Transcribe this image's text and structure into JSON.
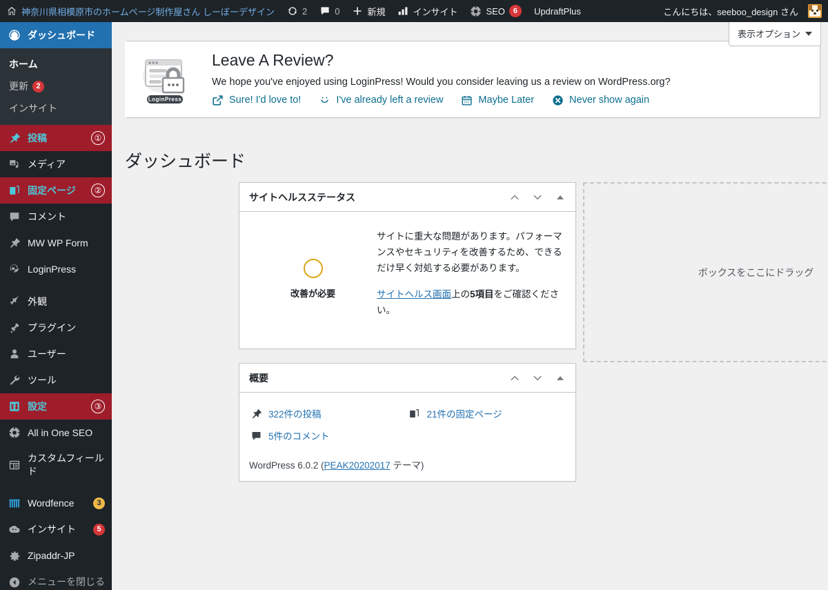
{
  "adminbar": {
    "site_name": "神奈川県相模原市のホームページ制作屋さん しーぼーデザイン",
    "updates_count": "2",
    "comments_count": "0",
    "new_label": "新規",
    "insight_label": "インサイト",
    "seo_label": "SEO",
    "seo_badge": "6",
    "updraftplus_label": "UpdraftPlus",
    "howdy": "こんにちは、seeboo_design さん"
  },
  "sidebar": {
    "items": [
      {
        "label": "ダッシュボード",
        "icon": "dashboard-icon",
        "state": "current",
        "marker": "",
        "badge": ""
      },
      {
        "label": "投稿",
        "icon": "pin-icon",
        "state": "flagged",
        "marker": "①",
        "badge": ""
      },
      {
        "label": "メディア",
        "icon": "media-icon",
        "state": "",
        "marker": "",
        "badge": ""
      },
      {
        "label": "固定ページ",
        "icon": "pages-icon",
        "state": "flagged",
        "marker": "②",
        "badge": ""
      },
      {
        "label": "コメント",
        "icon": "comment-icon",
        "state": "",
        "marker": "",
        "badge": ""
      },
      {
        "label": "MW WP Form",
        "icon": "pin-icon",
        "state": "",
        "marker": "",
        "badge": ""
      },
      {
        "label": "LoginPress",
        "icon": "loginpress-icon",
        "state": "",
        "marker": "",
        "badge": ""
      },
      {
        "label": "外観",
        "icon": "appearance-icon",
        "state": "",
        "marker": "",
        "badge": "",
        "sep_before": true
      },
      {
        "label": "プラグイン",
        "icon": "plugin-icon",
        "state": "",
        "marker": "",
        "badge": ""
      },
      {
        "label": "ユーザー",
        "icon": "users-icon",
        "state": "",
        "marker": "",
        "badge": ""
      },
      {
        "label": "ツール",
        "icon": "tools-icon",
        "state": "",
        "marker": "",
        "badge": ""
      },
      {
        "label": "設定",
        "icon": "settings-icon",
        "state": "flagged",
        "marker": "③",
        "badge": ""
      },
      {
        "label": "All in One SEO",
        "icon": "aioseo-icon",
        "state": "",
        "marker": "",
        "badge": ""
      },
      {
        "label": "カスタムフィールド",
        "icon": "customfields-icon",
        "state": "",
        "marker": "",
        "badge": ""
      },
      {
        "label": "Wordfence",
        "icon": "wordfence-icon",
        "state": "",
        "marker": "",
        "badge": "3",
        "badge_color": "orange",
        "sep_before": true
      },
      {
        "label": "インサイト",
        "icon": "insight-icon",
        "state": "",
        "marker": "",
        "badge": "5",
        "badge_color": "red"
      },
      {
        "label": "Zipaddr-JP",
        "icon": "gear-icon",
        "state": "",
        "marker": "",
        "badge": ""
      },
      {
        "label": "メニューを閉じる",
        "icon": "collapse-icon",
        "state": "collapse",
        "marker": "",
        "badge": ""
      }
    ],
    "submenu": [
      {
        "label": "ホーム",
        "active": true,
        "badge": ""
      },
      {
        "label": "更新",
        "active": false,
        "badge": "2"
      },
      {
        "label": "インサイト",
        "active": false,
        "badge": ""
      }
    ]
  },
  "screen_options": {
    "label": "表示オプション"
  },
  "notice": {
    "title": "Leave A Review?",
    "description": "We hope you've enjoyed using LoginPress! Would you consider leaving us a review on WordPress.org?",
    "logo_text": "LoginPress",
    "actions": [
      {
        "label": "Sure! I'd love to!",
        "icon": "external-link-icon"
      },
      {
        "label": "I've already left a review",
        "icon": "smiley-icon"
      },
      {
        "label": "Maybe Later",
        "icon": "calendar-icon"
      },
      {
        "label": "Never show again",
        "icon": "close-circle-icon"
      }
    ]
  },
  "page": {
    "title": "ダッシュボード"
  },
  "site_health": {
    "widget_title": "サイトヘルスステータス",
    "status_label": "改善が必要",
    "message": "サイトに重大な問題があります。パフォーマンスやセキュリティを改善するため、できるだけ早く対処する必要があります。",
    "link_prefix": "",
    "link_text": "サイトヘルス画面",
    "link_mid": "上の",
    "link_count": "5項目",
    "link_suffix": "をご確認ください。",
    "ring_color": "#dba617"
  },
  "at_a_glance": {
    "widget_title": "概要",
    "items": [
      {
        "label": "322件の投稿",
        "icon": "pin-icon"
      },
      {
        "label": "21件の固定ページ",
        "icon": "pages-icon"
      },
      {
        "label": "5件のコメント",
        "icon": "comment-icon"
      }
    ],
    "version_prefix": "WordPress 6.0.2 (",
    "theme_name": "PEAK20202017",
    "version_suffix": " テーマ)"
  },
  "drop_zone": {
    "label": "ボックスをここにドラッグ"
  },
  "widget_controls": {
    "up": "move-up",
    "down": "move-down",
    "toggle": "toggle-panel"
  },
  "colors": {
    "admin_bg": "#1d2327",
    "accent_blue": "#2271b1",
    "flagged_red": "#9f1d2b",
    "flagged_text": "#4ec7d8",
    "badge_red": "#d63638",
    "badge_orange": "#f0b849",
    "link_teal": "#0b6e8f"
  }
}
